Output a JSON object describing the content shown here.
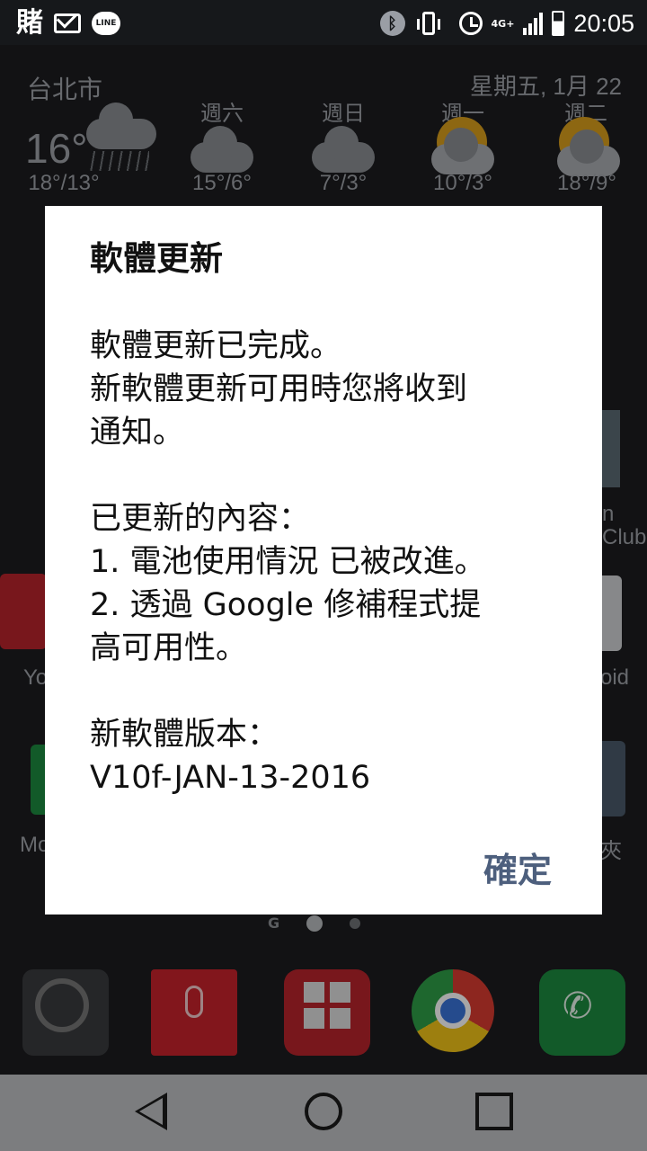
{
  "status_bar": {
    "left_app_glyph": "賭",
    "line_label": "LINE",
    "bluetooth_glyph": "ᛒ",
    "network_label": "4G+",
    "time": "20:05",
    "signal_bars": 4
  },
  "weather": {
    "city": "台北市",
    "date": "星期五, 1月 22",
    "current_temp": "16°",
    "today_range": "18°/13°",
    "forecast": [
      {
        "day": "週六",
        "range": "15°/6°",
        "icon": "cloud-rain-icon"
      },
      {
        "day": "週日",
        "range": "7°/3°",
        "icon": "cloud-rain-icon"
      },
      {
        "day": "週一",
        "range": "10°/3°",
        "icon": "sun-cloud-icon"
      },
      {
        "day": "週二",
        "range": "18°/9°",
        "icon": "sun-cloud-icon"
      }
    ]
  },
  "home": {
    "side_labels": {
      "left_a": "Yo",
      "left_b": "Mo",
      "right_a": "n",
      "right_b": "Club",
      "right_c": "oid",
      "right_d": "夾"
    },
    "page_indicator_g": "G"
  },
  "dialog": {
    "title": "軟體更新",
    "line1": "軟體更新已完成。",
    "line2": "新軟體更新可用時您將收到",
    "line3": "通知。",
    "line4": "已更新的內容：",
    "line5": "1. 電池使用情況 已被改進。",
    "line6": "2. 透過 Google 修補程式提",
    "line7": "高可用性。",
    "line8": "新軟體版本：",
    "line9": "V10f-JAN-13-2016",
    "ok_label": "確定"
  },
  "colors": {
    "dialog_button": "#4d5f7d",
    "nav_bar": "#7c7d7f",
    "status_bar": "#16181b"
  }
}
